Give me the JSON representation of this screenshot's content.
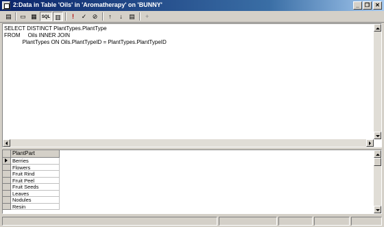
{
  "window": {
    "title": "2:Data in Table 'Oils' in 'Aromatherapy' on 'BUNNY'",
    "minimize_label": "_",
    "restore_label": "❐",
    "close_label": "✕"
  },
  "toolbar": {
    "buttons": [
      {
        "name": "properties-button",
        "glyph": "▤"
      },
      {
        "name": "show-diagram-pane-button",
        "glyph": "▭"
      },
      {
        "name": "show-grid-pane-button",
        "glyph": "▦"
      },
      {
        "name": "show-sql-pane-button",
        "glyph": "SQL"
      },
      {
        "name": "show-results-pane-button",
        "glyph": "▥"
      },
      {
        "name": "run-button",
        "glyph": "!"
      },
      {
        "name": "verify-sql-button",
        "glyph": "✓"
      },
      {
        "name": "remove-filter-button",
        "glyph": "⊘"
      },
      {
        "name": "sort-ascending-button",
        "glyph": "↑"
      },
      {
        "name": "sort-descending-button",
        "glyph": "↓"
      },
      {
        "name": "group-by-button",
        "glyph": "▤"
      },
      {
        "name": "add-table-button",
        "glyph": "+"
      }
    ]
  },
  "sql": {
    "text": "SELECT DISTINCT PlantTypes.PlantType\nFROM     Oils INNER JOIN\n            PlantTypes ON Oils.PlantTypeID = PlantTypes.PlantTypeID"
  },
  "grid": {
    "column_header": "PlantPart",
    "rows": [
      "Berries",
      "Flowers",
      "Fruit Rind",
      "Fruit Peel",
      "Fruit Seeds",
      "Leaves",
      "Nodules",
      "Resin"
    ]
  }
}
